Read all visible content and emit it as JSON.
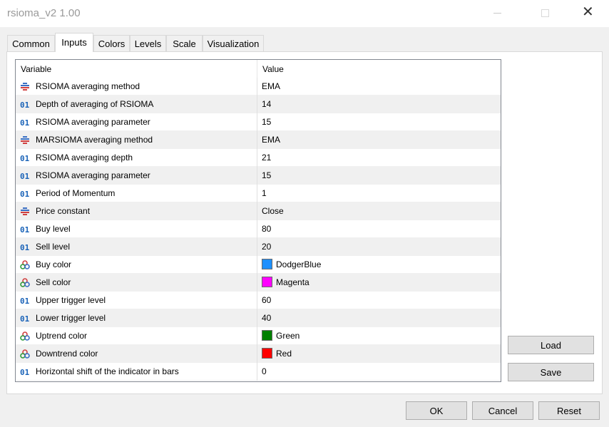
{
  "window": {
    "title": "rsioma_v2 1.00",
    "close_glyph": "✕"
  },
  "tabs": [
    {
      "label": "Common"
    },
    {
      "label": "Inputs"
    },
    {
      "label": "Colors"
    },
    {
      "label": "Levels"
    },
    {
      "label": "Scale"
    },
    {
      "label": "Visualization"
    }
  ],
  "active_tab": "Inputs",
  "table": {
    "columns": {
      "variable": "Variable",
      "value": "Value"
    },
    "rows": [
      {
        "icon": "enum-list-icon",
        "name": "RSIOMA averaging method",
        "value": "EMA"
      },
      {
        "icon": "integer-01-icon",
        "name": "Depth of averaging of RSIOMA",
        "value": "14"
      },
      {
        "icon": "integer-01-icon",
        "name": "RSIOMA averaging parameter",
        "value": "15"
      },
      {
        "icon": "enum-list-icon",
        "name": "MARSIOMA averaging method",
        "value": "EMA"
      },
      {
        "icon": "integer-01-icon",
        "name": "RSIOMA averaging depth",
        "value": "21"
      },
      {
        "icon": "integer-01-icon",
        "name": "RSIOMA averaging parameter",
        "value": "15"
      },
      {
        "icon": "integer-01-icon",
        "name": "Period of Momentum",
        "value": "1"
      },
      {
        "icon": "enum-list-icon",
        "name": "Price constant",
        "value": "Close"
      },
      {
        "icon": "integer-01-icon",
        "name": "Buy level",
        "value": "80"
      },
      {
        "icon": "integer-01-icon",
        "name": "Sell level",
        "value": "20"
      },
      {
        "icon": "color-circles-icon",
        "name": "Buy color",
        "value": "DodgerBlue",
        "swatch": "#1e90ff"
      },
      {
        "icon": "color-circles-icon",
        "name": "Sell color",
        "value": "Magenta",
        "swatch": "#ff00ff"
      },
      {
        "icon": "integer-01-icon",
        "name": "Upper trigger level",
        "value": "60"
      },
      {
        "icon": "integer-01-icon",
        "name": "Lower trigger level",
        "value": "40"
      },
      {
        "icon": "color-circles-icon",
        "name": "Uptrend color",
        "value": "Green",
        "swatch": "#008000"
      },
      {
        "icon": "color-circles-icon",
        "name": "Downtrend color",
        "value": "Red",
        "swatch": "#ff0000"
      },
      {
        "icon": "integer-01-icon",
        "name": "Horizontal shift of the indicator in bars",
        "value": "0"
      }
    ]
  },
  "buttons": {
    "load": "Load",
    "save": "Save",
    "ok": "OK",
    "cancel": "Cancel",
    "reset": "Reset"
  }
}
